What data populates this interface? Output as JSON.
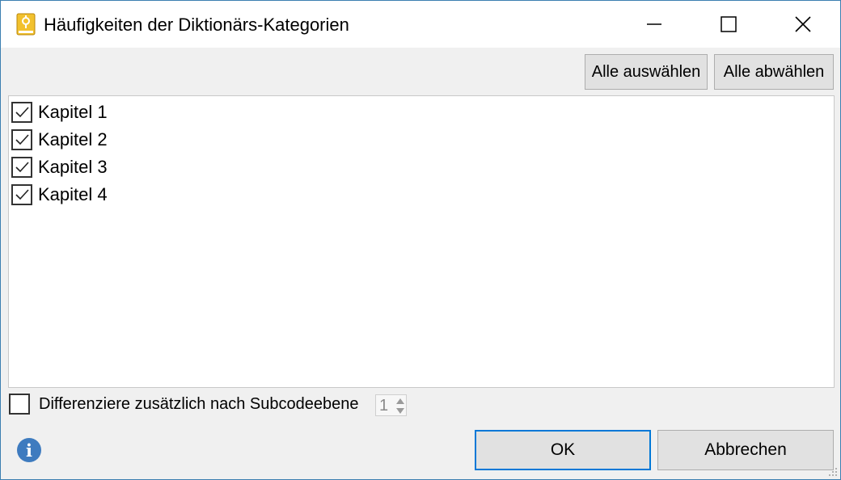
{
  "window": {
    "title": "Häufigkeiten der Diktionärs-Kategorien",
    "icon": "dictionary-book-icon",
    "controls": [
      "minimize-icon",
      "maximize-icon",
      "close-icon"
    ]
  },
  "toolbar": {
    "select_all": "Alle auswählen",
    "deselect_all": "Alle abwählen"
  },
  "categories": [
    {
      "label": "Kapitel 1",
      "checked": true
    },
    {
      "label": "Kapitel 2",
      "checked": true
    },
    {
      "label": "Kapitel 3",
      "checked": true
    },
    {
      "label": "Kapitel 4",
      "checked": true
    }
  ],
  "subcode_option": {
    "label": "Differenziere zusätzlich nach Subcodeebene",
    "checked": false,
    "level": "1"
  },
  "footer": {
    "info_icon": "i",
    "ok": "OK",
    "cancel": "Abbrechen"
  },
  "colors": {
    "accent": "#0078d7",
    "info": "#3e7bbf",
    "title_icon": "#f2c12e"
  }
}
